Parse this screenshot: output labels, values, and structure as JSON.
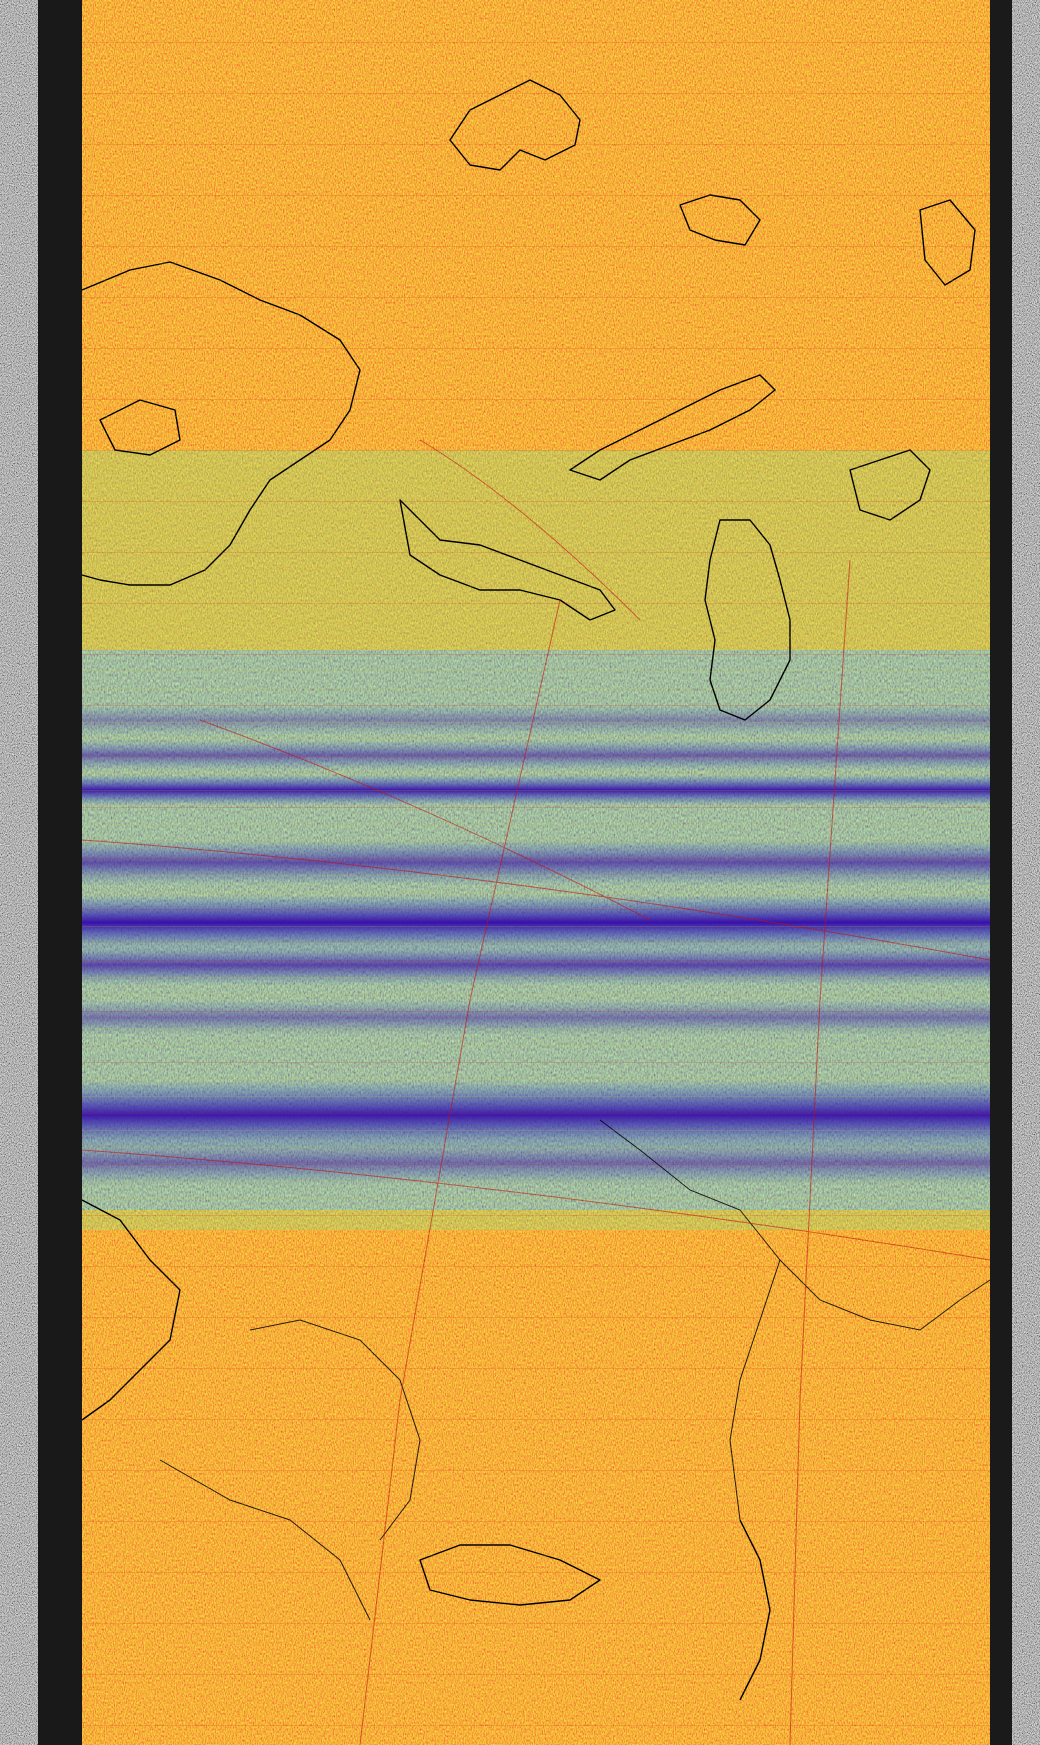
{
  "image": {
    "kind": "NOAA APT satellite image, false-color thermal enhancement with map overlay",
    "text": ""
  },
  "palette": {
    "hot": "#e0200c",
    "warm": "#f0781a",
    "mid": "#d6c21a",
    "mild": "#7fc23a",
    "cool": "#22b0b0",
    "cold": "#2a5ad8",
    "coldest": "#3a10a8",
    "overlay_coast": "#000000",
    "overlay_grid": "#c01010",
    "telemetry_dark": "#141414",
    "telemetry_light": "#d8d8d8"
  },
  "bands": [
    {
      "label": "band-1",
      "intensity": 0.35
    },
    {
      "label": "band-2",
      "intensity": 0.55
    },
    {
      "label": "band-3",
      "intensity": 0.95
    },
    {
      "label": "band-4",
      "intensity": 0.65
    },
    {
      "label": "band-5",
      "intensity": 1.0
    },
    {
      "label": "band-6",
      "intensity": 0.7
    },
    {
      "label": "band-7",
      "intensity": 0.45
    },
    {
      "label": "band-8",
      "intensity": 0.95
    },
    {
      "label": "band-9",
      "intensity": 0.5
    }
  ]
}
